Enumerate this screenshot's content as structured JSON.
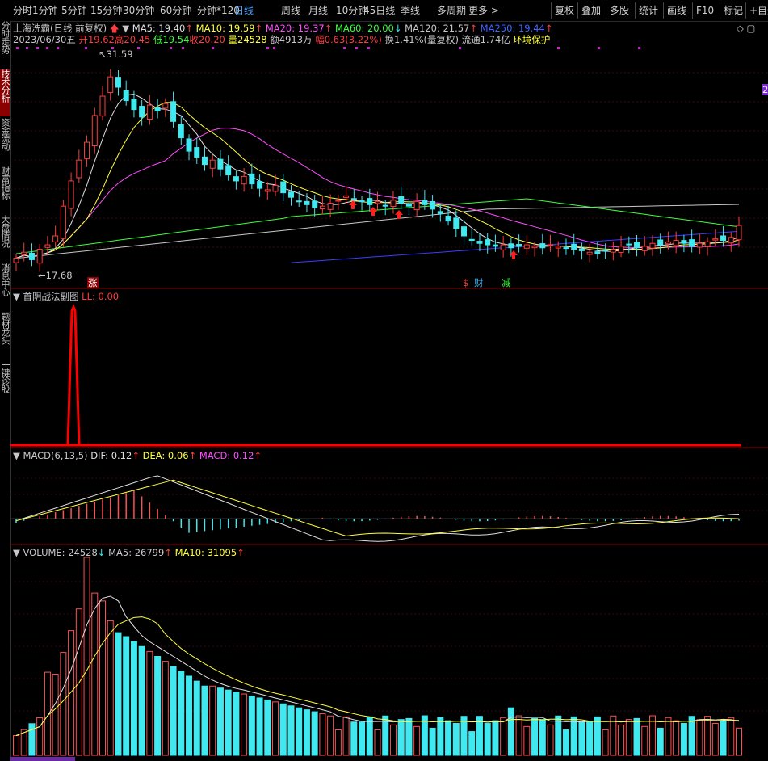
{
  "toolbar": {
    "periods": [
      "分时",
      "1分钟",
      "5分钟",
      "15分钟",
      "30分钟",
      "60分钟",
      "分钟*120",
      "日线",
      "周线",
      "月线",
      "10分钟",
      "45日线",
      "季线",
      "多周期",
      "更多 >"
    ],
    "active_period": "日线",
    "right_buttons": [
      "复权",
      "叠加",
      "多股",
      "统计",
      "画线",
      "F10",
      "标记",
      "+自选"
    ]
  },
  "sidebar": {
    "tabs": [
      "分时走势",
      "技术分析",
      "资金流动",
      "财富指标",
      "大盘情况",
      "消息中心",
      "题材龙头",
      "一键诊股"
    ],
    "active": "技术分析"
  },
  "main_panel": {
    "title": "上海洗霸(日线 前复权)",
    "ma": [
      {
        "label": "MA5: 19.40",
        "arrow": "↑",
        "color": "#e0e0e0"
      },
      {
        "label": "MA10: 19.59",
        "arrow": "↑",
        "color": "#ffff3c"
      },
      {
        "label": "MA20: 19.37",
        "arrow": "↑",
        "color": "#ff4cff"
      },
      {
        "label": "MA60: 20.00",
        "arrow": "↓",
        "color": "#3cff3c"
      },
      {
        "label": "MA120: 21.57",
        "arrow": "↑",
        "color": "#c8c8c8"
      },
      {
        "label": "MA250: 19.44",
        "arrow": "↑",
        "color": "#3c64ff"
      }
    ],
    "quote": {
      "date": "2023/06/30五",
      "open": "开19.62",
      "high": "高20.45",
      "low": "低19.54",
      "close": "收20.20",
      "vol": "量24528",
      "amount": "额4913万",
      "change": "幅0.63(3.22%)",
      "turnover": "换1.41%(量复权)",
      "float": "流通1.74亿",
      "tag": "环境保护"
    },
    "high_label": "31.59",
    "low_label": "17.68",
    "markers": {
      "zhang": "涨",
      "s": "$",
      "cai": "财",
      "jian": "减"
    },
    "right_edge_label": "2"
  },
  "sub_panel": {
    "title": "首阴战法副图",
    "ll": "LL: 0.00"
  },
  "macd_panel": {
    "title": "MACD(6,13,5)",
    "dif": "DIF: 0.12",
    "dea": "DEA: 0.06",
    "macd": "MACD: 0.12"
  },
  "volume_panel": {
    "vol": "VOLUME: 24528",
    "vol_arrow": "↓",
    "ma5": "MA5: 26799",
    "ma5_arrow": "↑",
    "ma10": "MA10: 31095",
    "ma10_arrow": "↑"
  },
  "chart_data": {
    "type": "candlestick",
    "price_range": [
      17.68,
      31.59
    ],
    "closes": [
      18.0,
      18.4,
      17.9,
      18.6,
      18.9,
      19.5,
      21.5,
      23.2,
      24.6,
      25.8,
      27.6,
      28.9,
      30.2,
      29.5,
      28.6,
      28.0,
      27.5,
      28.3,
      27.9,
      28.4,
      27.2,
      26.1,
      25.2,
      24.8,
      24.3,
      24.6,
      24.0,
      23.6,
      23.2,
      23.5,
      23.0,
      22.7,
      22.6,
      22.9,
      22.4,
      22.1,
      21.8,
      21.6,
      21.4,
      21.5,
      21.7,
      21.9,
      22.2,
      22.0,
      21.8,
      21.6,
      21.8,
      21.5,
      21.9,
      21.7,
      21.5,
      21.8,
      21.6,
      21.3,
      21.0,
      20.5,
      20.0,
      19.5,
      19.2,
      19.0,
      18.9,
      18.8,
      18.9,
      18.7,
      18.8,
      18.9,
      18.8,
      18.7,
      18.9,
      18.8,
      18.7,
      18.6,
      18.5,
      18.4,
      18.3,
      18.5,
      18.6,
      18.8,
      18.9,
      18.7,
      18.8,
      19.0,
      18.9,
      19.1,
      19.2,
      19.0,
      18.8,
      19.0,
      19.1,
      19.3,
      19.2,
      19.4,
      20.2
    ]
  }
}
